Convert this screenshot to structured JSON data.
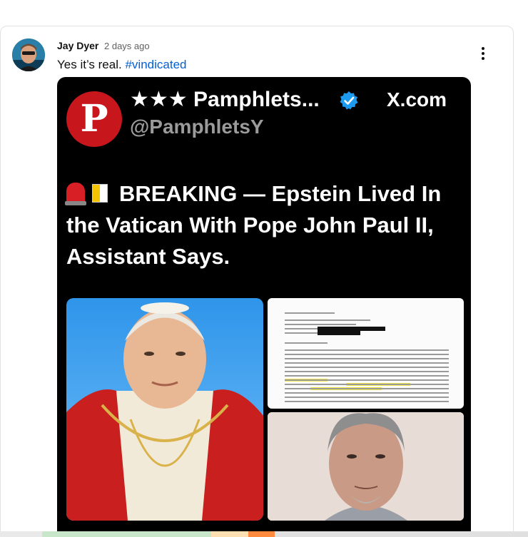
{
  "comment": {
    "author": "Jay Dyer",
    "time_ago": "2 days ago",
    "text": "Yes it’s real.",
    "hashtag": "#vindicated"
  },
  "post_image": {
    "account_name": "★★★ Pamphlets...",
    "handle": "@PamphletsY",
    "site": "X.com",
    "logo_letter": "P",
    "headline": "BREAKING — Epstein Lived In the Vatican With Pope John Paul II, Assistant Says."
  },
  "icons": {
    "menu": "more-vertical-icon",
    "verified": "verified-badge-icon",
    "siren": "siren-emoji-icon",
    "flag": "vatican-flag-icon"
  },
  "colors": {
    "link": "#065fd4",
    "logo_red": "#c8161d",
    "verified_blue": "#1d9bf0"
  }
}
